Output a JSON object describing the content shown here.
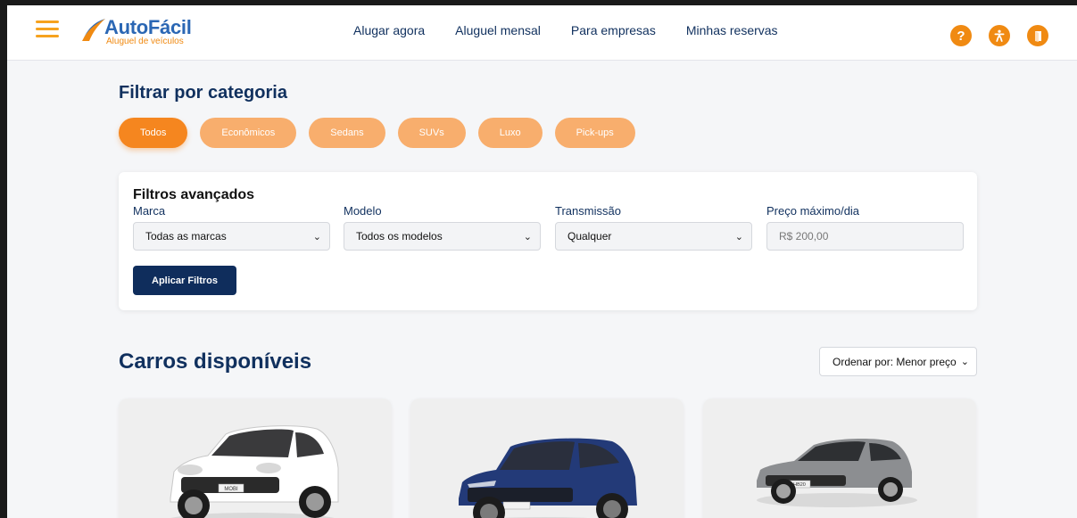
{
  "header": {
    "logo_title": "AutoFácil",
    "logo_subtitle": "Aluguel de veículos",
    "nav": [
      "Alugar agora",
      "Aluguel mensal",
      "Para empresas",
      "Minhas reservas"
    ],
    "icons": [
      "help-icon",
      "accessibility-icon",
      "logout-icon"
    ]
  },
  "category": {
    "title": "Filtrar por categoria",
    "pills": [
      "Todos",
      "Econômicos",
      "Sedans",
      "SUVs",
      "Luxo",
      "Pick-ups"
    ],
    "active": "Todos"
  },
  "filters": {
    "title": "Filtros avançados",
    "brand_label": "Marca",
    "brand_value": "Todas as marcas",
    "model_label": "Modelo",
    "model_value": "Todos os modelos",
    "transmission_label": "Transmissão",
    "transmission_value": "Qualquer",
    "price_label": "Preço máximo/dia",
    "price_placeholder": "R$ 200,00",
    "apply_label": "Aplicar Filtros"
  },
  "cars": {
    "title": "Carros disponíveis",
    "sort_value": "Ordenar por: Menor preço",
    "items": [
      {
        "color": "#ffffff",
        "plate": "MOBI"
      },
      {
        "color": "#233a78",
        "plate": ""
      },
      {
        "color": "#8c8e91",
        "plate": "HB20"
      }
    ]
  },
  "colors": {
    "accent": "#f5861f",
    "pill": "#f8ae6d",
    "navy": "#10305e",
    "button": "#0f2d5c"
  }
}
